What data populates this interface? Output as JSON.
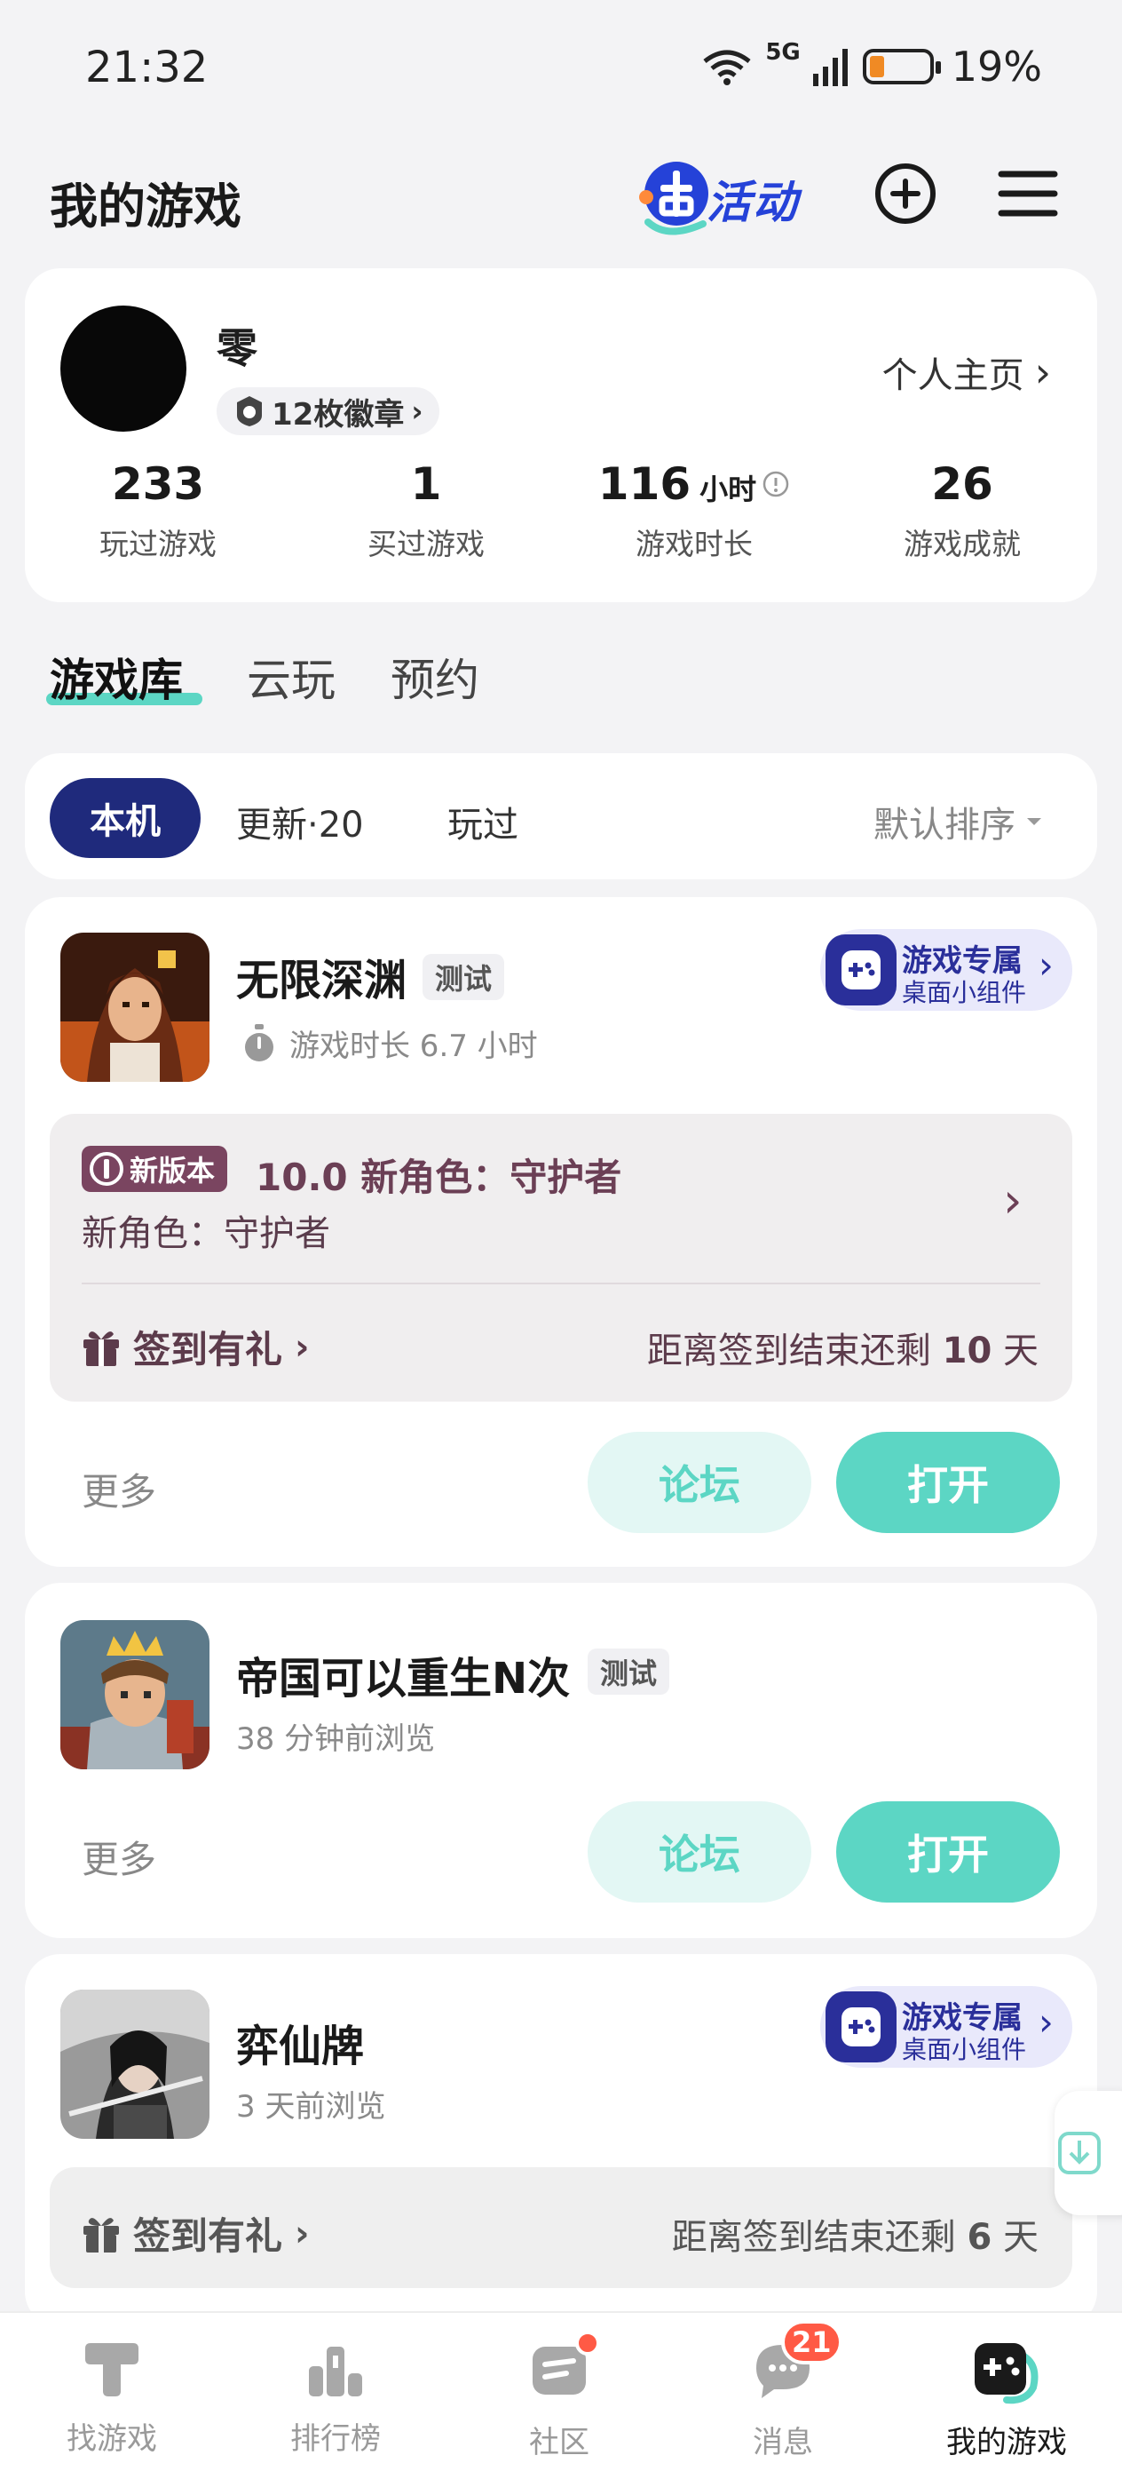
{
  "status": {
    "time": "21:32",
    "network": "5G",
    "battery": "19%"
  },
  "header": {
    "title": "我的游戏",
    "activity": "活动"
  },
  "profile": {
    "username": "零",
    "badges": "12枚徽章",
    "profile_link": "个人主页",
    "stats": [
      {
        "value": "233",
        "unit": "",
        "label": "玩过游戏"
      },
      {
        "value": "1",
        "unit": "",
        "label": "买过游戏"
      },
      {
        "value": "116",
        "unit": "小时",
        "label": "游戏时长"
      },
      {
        "value": "26",
        "unit": "",
        "label": "游戏成就"
      }
    ]
  },
  "library_tabs": [
    "游戏库",
    "云玩",
    "预约"
  ],
  "filters": {
    "active": "本机",
    "update": "更新·20",
    "played": "玩过",
    "sort": "默认排序"
  },
  "widget": {
    "title": "游戏专属",
    "subtitle": "桌面小组件"
  },
  "games": [
    {
      "name": "无限深渊",
      "tag": "测试",
      "meta": "游戏时长 6.7 小时",
      "news_tag": "新版本",
      "news_title": "10.0 新角色：守护者",
      "news_sub": "新角色：守护者",
      "gift": "签到有礼",
      "countdown_prefix": "距离签到结束还剩",
      "countdown_num": "10",
      "countdown_suffix": "天",
      "more": "更多",
      "forum": "论坛",
      "open": "打开"
    },
    {
      "name": "帝国可以重生N次",
      "tag": "测试",
      "meta": "38 分钟前浏览",
      "more": "更多",
      "forum": "论坛",
      "open": "打开"
    },
    {
      "name": "弈仙牌",
      "meta": "3 天前浏览",
      "gift": "签到有礼",
      "countdown_prefix": "距离签到结束还剩",
      "countdown_num": "6",
      "countdown_suffix": "天"
    }
  ],
  "nav": [
    {
      "label": "找游戏",
      "icon": "find-game-icon"
    },
    {
      "label": "排行榜",
      "icon": "ranking-icon"
    },
    {
      "label": "社区",
      "icon": "community-icon"
    },
    {
      "label": "消息",
      "icon": "message-icon",
      "badge": "21"
    },
    {
      "label": "我的游戏",
      "icon": "my-games-icon"
    }
  ],
  "colors": {
    "accent": "#5cd6c4",
    "navy": "#1f2a7c",
    "badge": "#ff5a45"
  }
}
